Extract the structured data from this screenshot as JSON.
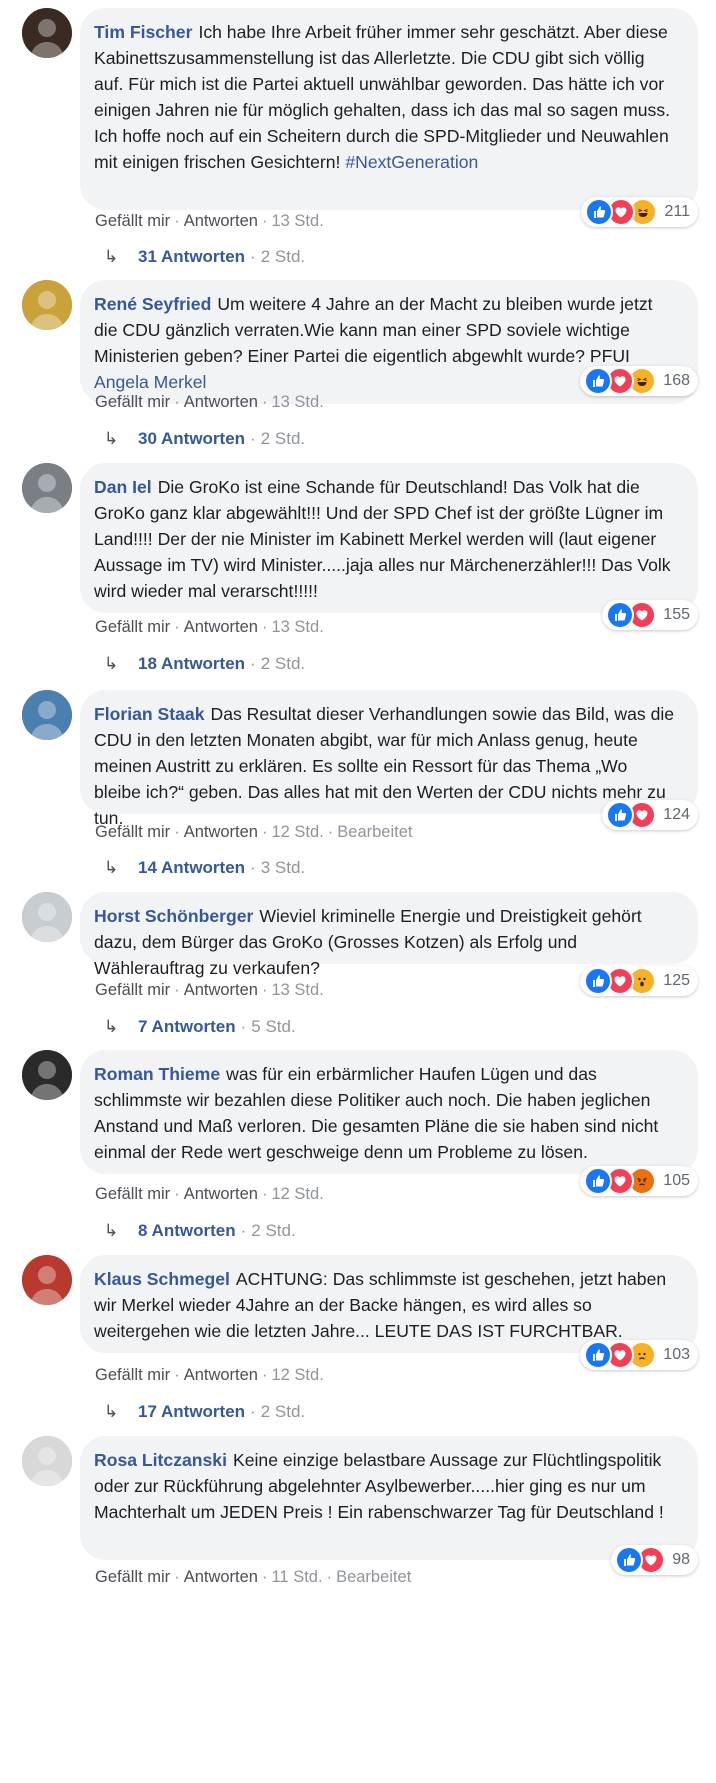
{
  "labels": {
    "like": "Gefällt mir",
    "reply": "Antworten",
    "separator": "·",
    "reply_arrow": "↳"
  },
  "comments": [
    {
      "author": "Tim Fischer",
      "text": "Ich habe Ihre Arbeit früher immer sehr geschätzt. Aber diese Kabinettszusammenstellung ist das Allerletzte. Die CDU gibt sich völlig auf. Für mich ist die Partei aktuell unwählbar geworden. Das hätte ich vor einigen Jahren nie für möglich gehalten, dass ich das mal so sagen muss. Ich hoffe noch auf ein Scheitern durch die SPD-Mitglieder und Neuwahlen mit einigen frischen Gesichtern!",
      "hashtag": "#NextGeneration",
      "mention": "",
      "time": "13 Std.",
      "edited": "",
      "reactions": [
        "like",
        "love",
        "haha"
      ],
      "reaction_count": "211",
      "reply_count": "31 Antworten",
      "reply_time": "2 Std.",
      "avatar_color": "#3a2a22"
    },
    {
      "author": "René Seyfried",
      "text": "Um weitere 4 Jahre an der Macht zu bleiben wurde jetzt die CDU gänzlich verraten.Wie kann man einer SPD soviele wichtige Ministerien geben? Einer Partei die eigentlich abgewhlt wurde? PFUI",
      "hashtag": "",
      "mention": "Angela Merkel",
      "time": "13 Std.",
      "edited": "",
      "reactions": [
        "like",
        "love",
        "haha"
      ],
      "reaction_count": "168",
      "reply_count": "30 Antworten",
      "reply_time": "2 Std.",
      "avatar_color": "#c9a23a"
    },
    {
      "author": "Dan Iel",
      "text": "Die GroKo ist eine Schande für Deutschland! Das Volk hat die GroKo ganz klar abgewählt!!! Und der SPD Chef ist der größte Lügner im Land!!!! Der der nie Minister im Kabinett Merkel werden will (laut eigener Aussage im TV) wird Minister.....jaja alles nur Märchenerzähler!!! Das Volk wird wieder mal verarscht!!!!!",
      "hashtag": "",
      "mention": "",
      "time": "13 Std.",
      "edited": "",
      "reactions": [
        "like",
        "love"
      ],
      "reaction_count": "155",
      "reply_count": "18 Antworten",
      "reply_time": "2 Std.",
      "avatar_color": "#7a7f86"
    },
    {
      "author": "Florian Staak",
      "text": "Das Resultat dieser Verhandlungen sowie das Bild, was die CDU in den letzten Monaten abgibt, war für mich Anlass genug, heute meinen Austritt zu erklären. Es sollte ein Ressort für das Thema „Wo bleibe ich?“ geben. Das alles hat mit den Werten der CDU nichts mehr zu tun.",
      "hashtag": "",
      "mention": "",
      "time": "12 Std.",
      "edited": "Bearbeitet",
      "reactions": [
        "like",
        "love"
      ],
      "reaction_count": "124",
      "reply_count": "14 Antworten",
      "reply_time": "3 Std.",
      "avatar_color": "#4b7fb0"
    },
    {
      "author": "Horst Schönberger",
      "text": "Wieviel kriminelle Energie und Dreistigkeit gehört dazu, dem Bürger das GroKo (Grosses Kotzen) als Erfolg und Wählerauftrag zu verkaufen?",
      "hashtag": "",
      "mention": "",
      "time": "13 Std.",
      "edited": "",
      "reactions": [
        "like",
        "love",
        "wow"
      ],
      "reaction_count": "125",
      "reply_count": "7 Antworten",
      "reply_time": "5 Std.",
      "avatar_color": "#c8cdd2"
    },
    {
      "author": "Roman Thieme",
      "text": "was für ein erbärmlicher Haufen Lügen und das schlimmste wir bezahlen diese Politiker auch noch. Die haben jeglichen Anstand und Maß verloren. Die gesamten Pläne die sie haben sind nicht einmal der Rede wert geschweige denn um Probleme zu lösen.",
      "hashtag": "",
      "mention": "",
      "time": "12 Std.",
      "edited": "",
      "reactions": [
        "like",
        "love",
        "angry"
      ],
      "reaction_count": "105",
      "reply_count": "8 Antworten",
      "reply_time": "2 Std.",
      "avatar_color": "#2a2a2a"
    },
    {
      "author": "Klaus Schmegel",
      "text": "ACHTUNG: Das schlimmste ist geschehen, jetzt haben wir Merkel wieder 4Jahre an der Backe hängen, es wird alles so weitergehen wie die letzten Jahre... LEUTE DAS IST FURCHTBAR.",
      "hashtag": "",
      "mention": "",
      "time": "12 Std.",
      "edited": "",
      "reactions": [
        "like",
        "love",
        "sad"
      ],
      "reaction_count": "103",
      "reply_count": "17 Antworten",
      "reply_time": "2 Std.",
      "avatar_color": "#b83a2e"
    },
    {
      "author": "Rosa Litczanski",
      "text": "Keine einzige belastbare Aussage zur Flüchtlingspolitik oder zur Rückführung abgelehnter Asylbewerber.....hier ging es nur um Machterhalt um JEDEN Preis ! Ein rabenschwarzer Tag für Deutschland !",
      "hashtag": "",
      "mention": "",
      "time": "11 Std.",
      "edited": "Bearbeitet",
      "reactions": [
        "like",
        "love"
      ],
      "reaction_count": "98",
      "reply_count": "",
      "reply_time": "",
      "avatar_color": "#d8d8d8"
    }
  ],
  "colors": {
    "link": "#365899",
    "meta": "#90949c",
    "bubble": "#f2f3f5",
    "like": "#1877f2",
    "love": "#f33e58",
    "emoji": "#f7b125"
  }
}
